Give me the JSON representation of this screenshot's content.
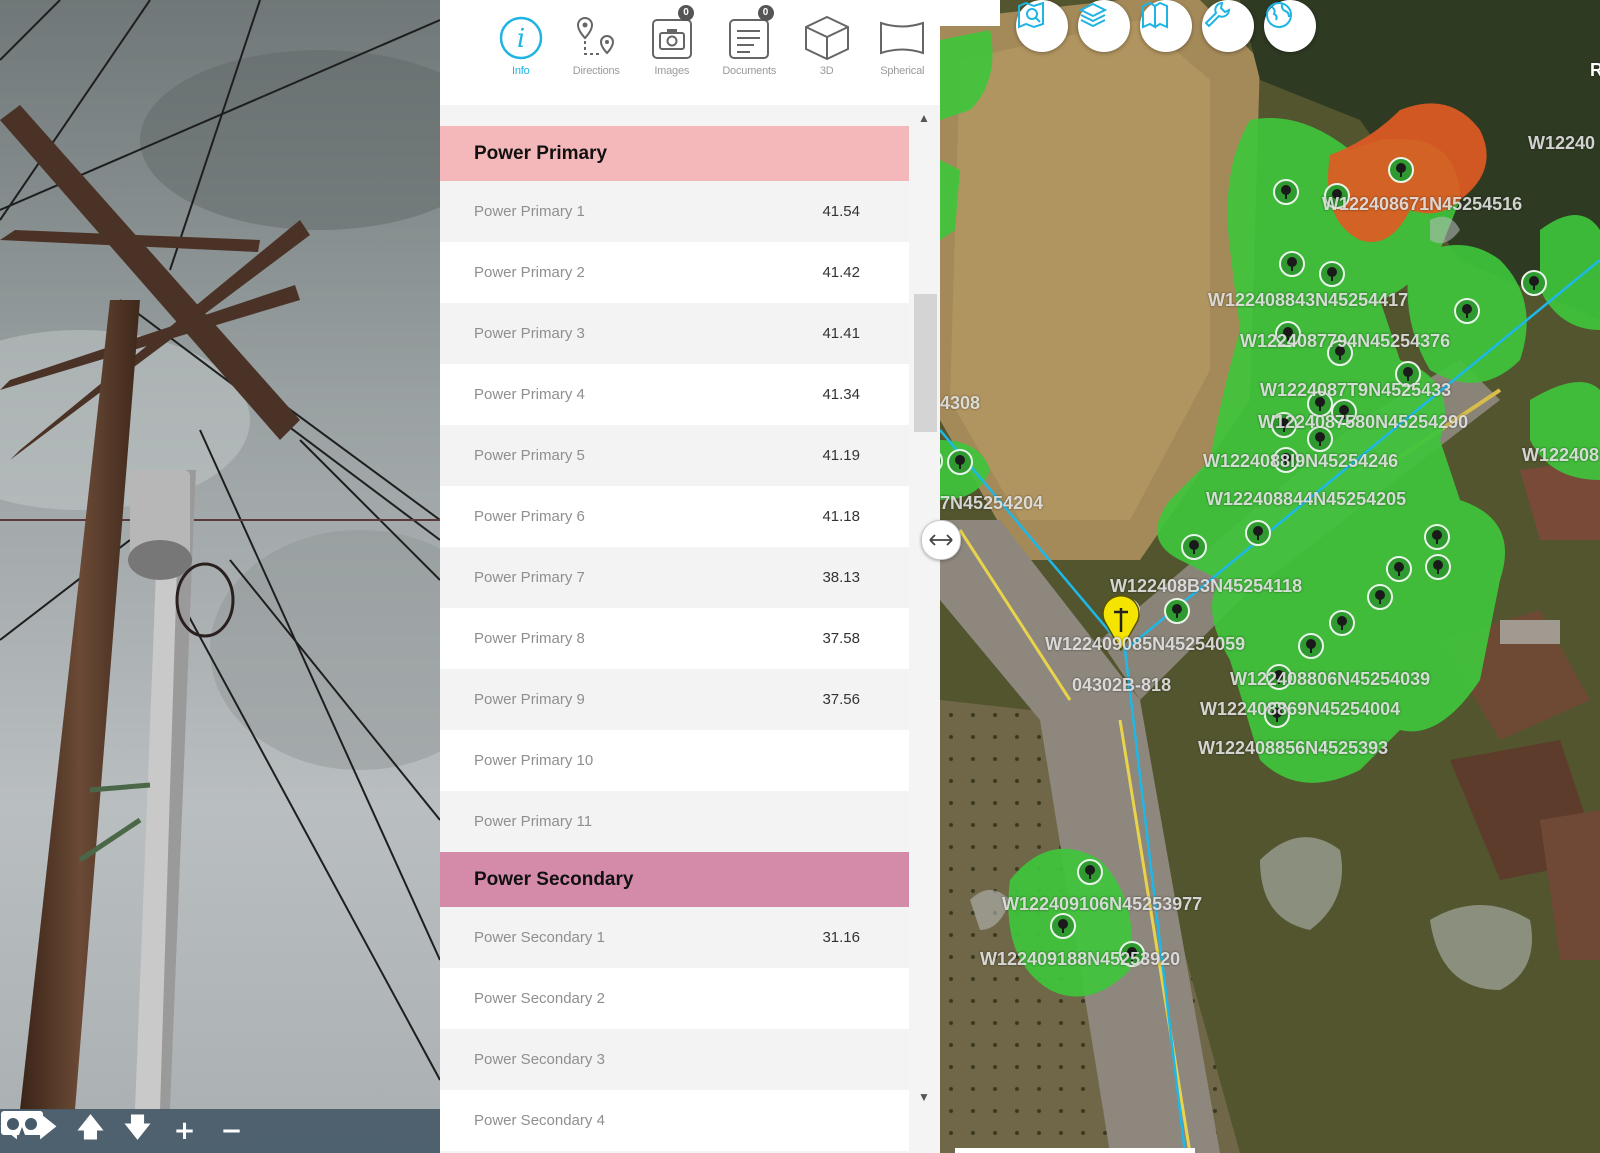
{
  "photo_toolbar": {
    "buttons": [
      "🡄",
      "🡆",
      "🡅",
      "🡇",
      "+",
      "−"
    ]
  },
  "tool_tabs": [
    {
      "label": "Info",
      "icon": "info-icon",
      "active": true
    },
    {
      "label": "Directions",
      "icon": "directions-icon"
    },
    {
      "label": "Images",
      "icon": "camera-icon",
      "badge": "0"
    },
    {
      "label": "Documents",
      "icon": "document-icon",
      "badge": "0"
    },
    {
      "label": "3D",
      "icon": "cube-icon"
    },
    {
      "label": "Spherical",
      "icon": "spherical-icon"
    }
  ],
  "sections": [
    {
      "title": "Power Primary",
      "color": "#f5b8ba",
      "rows": [
        {
          "name": "Power Primary 1",
          "value": "41.54"
        },
        {
          "name": "Power Primary 2",
          "value": "41.42"
        },
        {
          "name": "Power Primary 3",
          "value": "41.41"
        },
        {
          "name": "Power Primary 4",
          "value": "41.34"
        },
        {
          "name": "Power Primary 5",
          "value": "41.19"
        },
        {
          "name": "Power Primary 6",
          "value": "41.18"
        },
        {
          "name": "Power Primary 7",
          "value": "38.13"
        },
        {
          "name": "Power Primary 8",
          "value": "37.58"
        },
        {
          "name": "Power Primary 9",
          "value": "37.56"
        },
        {
          "name": "Power Primary 10",
          "value": ""
        },
        {
          "name": "Power Primary 11",
          "value": ""
        }
      ]
    },
    {
      "title": "Power Secondary",
      "color": "#d48aa9",
      "rows": [
        {
          "name": "Power Secondary 1",
          "value": "31.16"
        },
        {
          "name": "Power Secondary 2",
          "value": ""
        },
        {
          "name": "Power Secondary 3",
          "value": ""
        },
        {
          "name": "Power Secondary 4",
          "value": ""
        }
      ]
    }
  ],
  "map_buttons": [
    "map-search-icon",
    "layers-icon",
    "map-compare-icon",
    "wrench-icon",
    "globe-icon"
  ],
  "map_labels": [
    {
      "text": "W122408671N45254516"
    },
    {
      "text": "W122408843N45254417"
    },
    {
      "text": "W1224087794N45254376"
    },
    {
      "text": "W1224087T9N4525433"
    },
    {
      "text": "W1224087580N45254290"
    },
    {
      "text": "W1224088I9N45254246"
    },
    {
      "text": "W122408844N45254205"
    },
    {
      "text": "W122408B3N45254118"
    },
    {
      "text": "W122409085N45254059"
    },
    {
      "text": "04302B-818"
    },
    {
      "text": "W122408806N45254039"
    },
    {
      "text": "W122408869N45254004"
    },
    {
      "text": "W122408856N4525393"
    },
    {
      "text": "W122409106N45253977"
    },
    {
      "text": "W122409188N45253920"
    },
    {
      "text": "W12240"
    },
    {
      "text": "W122408"
    },
    {
      "text": "7N45254204"
    },
    {
      "text": "4308"
    },
    {
      "text": "R"
    }
  ],
  "accent_color": "#1fb4e4"
}
